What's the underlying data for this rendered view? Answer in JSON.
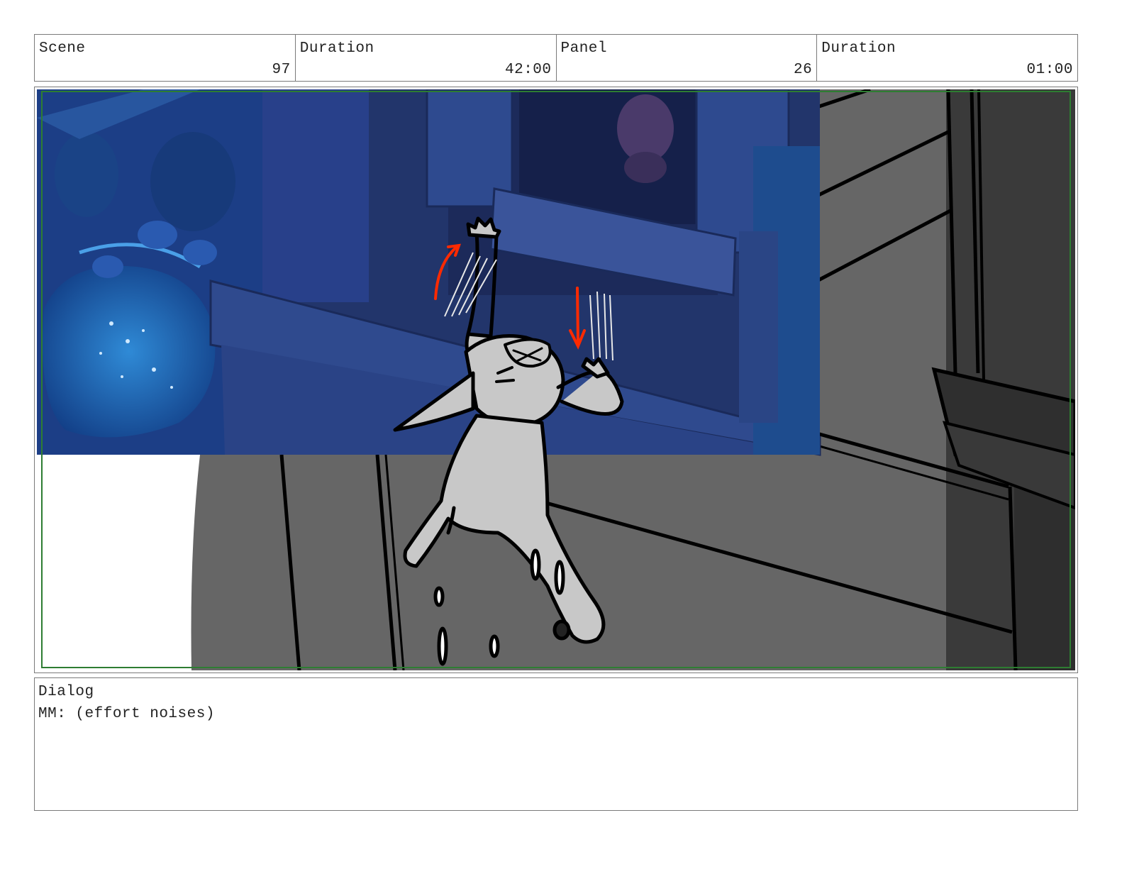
{
  "header": {
    "scene_label": "Scene",
    "scene_value": "97",
    "scene_duration_label": "Duration",
    "scene_duration_value": "42:00",
    "panel_label": "Panel",
    "panel_value": "26",
    "panel_duration_label": "Duration",
    "panel_duration_value": "01:00"
  },
  "dialog": {
    "label": "Dialog",
    "text": "MM: (effort noises)"
  },
  "colors": {
    "border": "#7a7a7a",
    "safe_frame": "#2e7d32",
    "night_blue": "#1d3a78",
    "wall_gray": "#666666",
    "arrow_red": "#ff2a00"
  }
}
